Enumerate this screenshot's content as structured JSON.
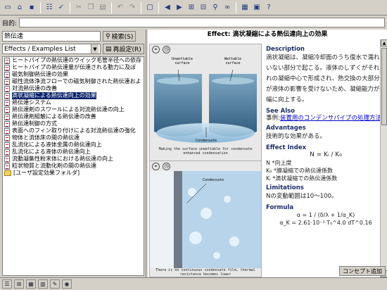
{
  "toolbar": {
    "icons": [
      "new-doc-icon",
      "open-icon",
      "save-icon",
      "properties-icon",
      "spell-icon",
      "cut-icon",
      "copy-icon",
      "paste-icon",
      "undo-icon",
      "redo-icon",
      "window-icon",
      "back-icon",
      "forward-icon",
      "tree-icon",
      "link-icon",
      "find-icon",
      "binoculars-icon",
      "text-icon",
      "image-icon",
      "help-icon"
    ]
  },
  "address": {
    "label": "目的:",
    "value": ""
  },
  "left": {
    "search_value": "熱伝達",
    "search_button": "検索(S)",
    "filter_value": "Effects / Examples List",
    "reset_button": "再設定(R)",
    "items": [
      "ヒートパイプの熱伝達のウイック毛管半径への依存",
      "ヒートパイプの熱伝達量が伝達される動力に及ぼ",
      "磁気制御熱伝達の効果",
      "磁性流体浄流フローでの磁気制御された熱伝達およ",
      "対流熱伝達の改善",
      "滴状凝縮による熱伝達向上の効果",
      "熱伝達システム",
      "熱伝達剤のスワールによる対流熱伝達の向上",
      "熱伝達剤組触による熱伝達の改善",
      "熱伝達制御の方式",
      "表面へのフィン取り付けによる対流熱伝達の強化",
      "物体と流体床の間の熱伝達",
      "乱流化による液体金属の熱伝達向上",
      "乱流化による液体の熱伝達向上",
      "流動凝集性粉末体における熱伝達の向上",
      "粒状物質と流動化剤の間の熱伝達"
    ],
    "folder": "[ユーザ設定効果フォルダ]",
    "selected_index": 5
  },
  "right": {
    "title": "Effect: 滴状凝縮による熱伝達向上の効果",
    "fig1": {
      "label_left": "Unwettable surface",
      "label_right": "Wettable surface",
      "label_bottom": "Condensate",
      "caption": "Making the surface unwettable for condensate enhanced condensation"
    },
    "fig2": {
      "label": "Condensate",
      "caption": "There is no continuous condensate film, thermal resistance becomes lower"
    },
    "description_heading": "Description",
    "description_text": "滴状凝縮は、凝縮冷却面のうち復水で濡れていない部分で起こる。液体のしずくがそれぞれの凝縮中心で形成され、熱交換の大部分が液体の影響を受けないため、凝縮能力が大幅に向上する。",
    "see_also_heading": "See Also",
    "see_also_prefix": "事例:",
    "see_also_link": "装置用のコンデンサパイプの処理方法",
    "advantages_heading": "Advantages",
    "advantages_text": "技術的な効果がある。",
    "effect_index_heading": "Effect Index",
    "effect_index_formula": "N = Kᵢ / K₀",
    "effect_index_defs": [
      "N *向上度",
      "K₀ *膜凝縮での熱伝達係数",
      "Kᵢ *滴状凝縮での熱伝達係数"
    ],
    "limitations_heading": "Limitations",
    "limitations_text": "Nの変動範囲は10〜100。",
    "formula_heading": "Formula",
    "formula_1": "α = 1 / (δ/λ + 1/α_K)",
    "formula_2": "α_K = 2.61·10⁻²·T₀^4.0 dT^0.16",
    "add_button": "コンセプト追加"
  },
  "bottom": {
    "icons": [
      "list-view-icon",
      "tree-view-icon",
      "grid-view-icon",
      "chart-view-icon",
      "edit-icon",
      "globe-icon"
    ]
  }
}
